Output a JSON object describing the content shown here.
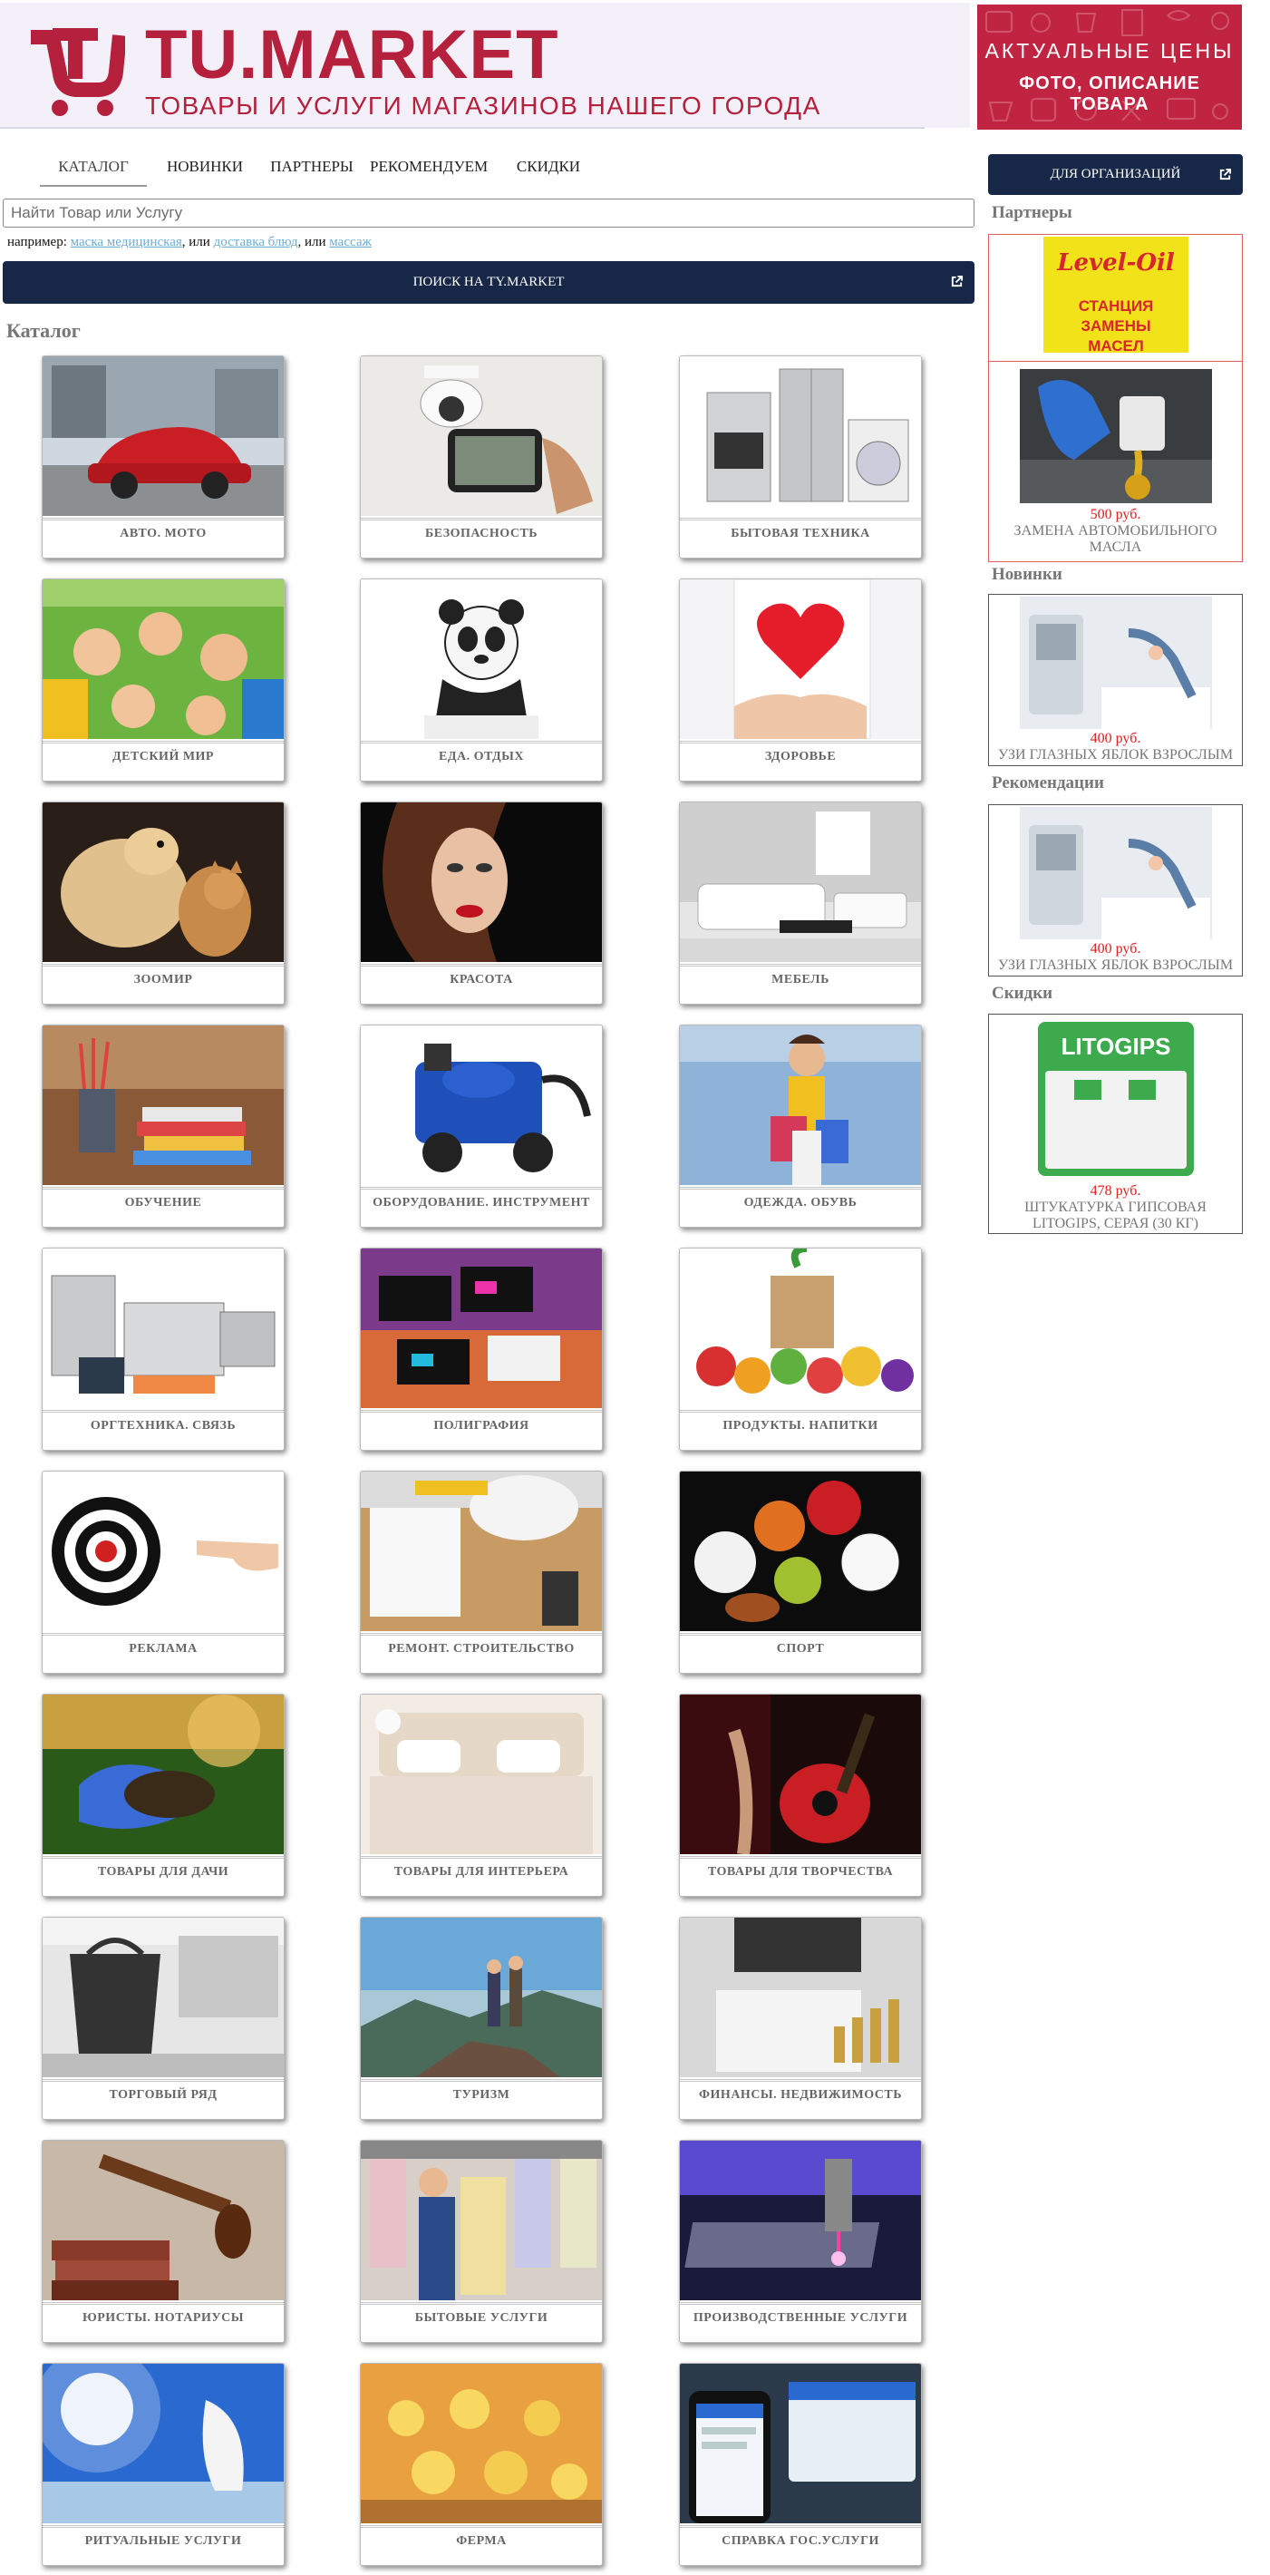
{
  "header": {
    "logo_icon": "shopping-cart-logo-icon",
    "brand_name": "TU.MARKET",
    "tagline": "ТОВАРЫ И УСЛУГИ МАГАЗИНОВ НАШЕГО ГОРОДА",
    "promo": {
      "line1": "АКТУАЛЬНЫЕ ЦЕНЫ",
      "line2": "ФОТО, ОПИСАНИЕ ТОВАРА"
    },
    "colors": {
      "brand": "#b5203d",
      "header_bg": "#f3f0fa",
      "promo_bg": "#c02440"
    }
  },
  "nav": {
    "items": [
      {
        "label": "КАТАЛОГ",
        "active": true
      },
      {
        "label": "НОВИНКИ"
      },
      {
        "label": "ПАРТНЕРЫ"
      },
      {
        "label": "РЕКОМЕНДУЕМ"
      },
      {
        "label": "СКИДКИ"
      }
    ]
  },
  "org_button": {
    "label": "ДЛЯ ОРГАНИЗАЦИЙ",
    "icon": "external-link-icon"
  },
  "search": {
    "placeholder": "Найти Товар или Услугу",
    "value": "",
    "examples_prefix": "например:",
    "examples": [
      "маска медицинская",
      "доставка блюд",
      "массаж"
    ],
    "separator": ", или",
    "button_label": "ПОИСК НА TY.MARKET",
    "button_icon": "external-link-icon"
  },
  "catalog": {
    "heading": "Каталог",
    "items": [
      {
        "label": "АВТО. МОТО",
        "image": "car-photo"
      },
      {
        "label": "БЕЗОПАСНОСТЬ",
        "image": "security-camera-photo"
      },
      {
        "label": "БЫТОВАЯ ТЕХНИКА",
        "image": "home-appliances-photo"
      },
      {
        "label": "ДЕТСКИЙ МИР",
        "image": "children-photo"
      },
      {
        "label": "ЕДА. ОТДЫХ",
        "image": "panda-photo"
      },
      {
        "label": "ЗДОРОВЬЕ",
        "image": "heart-hands-photo"
      },
      {
        "label": "ЗООМИР",
        "image": "dog-cat-photo"
      },
      {
        "label": "КРАСОТА",
        "image": "beauty-face-photo"
      },
      {
        "label": "МЕБЕЛЬ",
        "image": "white-sofa-photo"
      },
      {
        "label": "ОБУЧЕНИЕ",
        "image": "books-pencils-photo"
      },
      {
        "label": "ОБОРУДОВАНИЕ. ИНСТРУМЕНТ",
        "image": "blue-machine-photo"
      },
      {
        "label": "ОДЕЖДА. ОБУВЬ",
        "image": "shopping-girl-photo"
      },
      {
        "label": "ОРГТЕХНИКА. СВЯЗЬ",
        "image": "printers-photo"
      },
      {
        "label": "ПОЛИГРАФИЯ",
        "image": "business-cards-photo"
      },
      {
        "label": "ПРОДУКТЫ. НАПИТКИ",
        "image": "groceries-photo"
      },
      {
        "label": "РЕКЛАМА",
        "image": "target-hand-photo"
      },
      {
        "label": "РЕМОНТ. СТРОИТЕЛЬСТВО",
        "image": "construction-desk-photo"
      },
      {
        "label": "СПОРТ",
        "image": "sport-balls-photo"
      },
      {
        "label": "ТОВАРЫ ДЛЯ ДАЧИ",
        "image": "soil-gloves-photo"
      },
      {
        "label": "ТОВАРЫ ДЛЯ ИНТЕРЬЕРА",
        "image": "bed-interior-photo"
      },
      {
        "label": "ТОВАРЫ ДЛЯ ТВОРЧЕСТВА",
        "image": "guitar-photo"
      },
      {
        "label": "ТОРГОВЫЙ РЯД",
        "image": "shopping-bag-store-photo"
      },
      {
        "label": "ТУРИЗМ",
        "image": "hikers-mountain-photo"
      },
      {
        "label": "ФИНАНСЫ. НЕДВИЖИМОСТЬ",
        "image": "finance-coins-photo"
      },
      {
        "label": "ЮРИСТЫ. НОТАРИУСЫ",
        "image": "gavel-books-photo"
      },
      {
        "label": "БЫТОВЫЕ УСЛУГИ",
        "image": "dry-cleaning-photo"
      },
      {
        "label": "ПРОИЗВОДСТВЕННЫЕ УСЛУГИ",
        "image": "laser-cutting-photo"
      },
      {
        "label": "РИТУАЛЬНЫЕ УСЛУГИ",
        "image": "angel-sky-photo"
      },
      {
        "label": "ФЕРМА",
        "image": "chicks-photo"
      },
      {
        "label": "СПРАВКА ГОС.УСЛУГИ",
        "image": "gosuslugi-phone-photo"
      }
    ]
  },
  "sidebar": {
    "partners": {
      "heading": "Партнеры",
      "logo": {
        "brand": "Level-Oil",
        "subtitle": "СТАНЦИЯ ЗАМЕНЫ МАСЕЛ",
        "image": "level-oil-logo"
      },
      "product": {
        "price": "500 руб.",
        "name": "ЗАМЕНА АВТОМОБИЛЬНОГО МАСЛА",
        "image": "oil-pour-photo"
      }
    },
    "new": {
      "heading": "Новинки",
      "price": "400 руб.",
      "name": "УЗИ ГЛАЗНЫХ ЯБЛОК ВЗРОСЛЫМ",
      "image": "ultrasound-photo"
    },
    "recommended": {
      "heading": "Рекомендации",
      "price": "400 руб.",
      "name": "УЗИ ГЛАЗНЫХ ЯБЛОК ВЗРОСЛЫМ",
      "image": "ultrasound-photo"
    },
    "discounts": {
      "heading": "Скидки",
      "price": "478 руб.",
      "name": "ШТУКАТУРКА ГИПСОВАЯ LITOGIPS, СЕРАЯ (30 КГ)",
      "product_brand": "LITOGIPS",
      "image": "litogips-bag-photo"
    }
  }
}
